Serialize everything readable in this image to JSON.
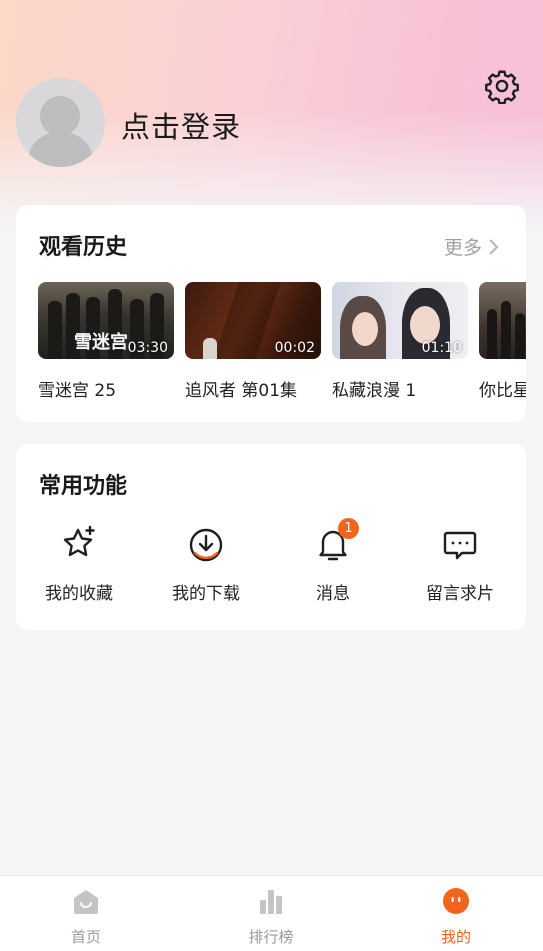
{
  "header": {
    "login_text": "点击登录",
    "settings_icon": "gear-icon",
    "avatar_icon": "default-avatar-icon"
  },
  "history": {
    "title": "观看历史",
    "more_label": "更多",
    "items": [
      {
        "title": "雪迷宫 25",
        "duration": "03:30"
      },
      {
        "title": "追风者 第01集",
        "duration": "00:02"
      },
      {
        "title": "私藏浪漫 1",
        "duration": "01:10"
      },
      {
        "title": "你比星",
        "duration": ""
      }
    ]
  },
  "features": {
    "title": "常用功能",
    "items": [
      {
        "label": "我的收藏",
        "icon": "star-icon"
      },
      {
        "label": "我的下载",
        "icon": "download-icon"
      },
      {
        "label": "消息",
        "icon": "bell-icon",
        "badge": "1"
      },
      {
        "label": "留言求片",
        "icon": "chat-icon"
      }
    ]
  },
  "tabbar": {
    "items": [
      {
        "label": "首页",
        "icon": "home-icon"
      },
      {
        "label": "排行榜",
        "icon": "chart-icon"
      },
      {
        "label": "我的",
        "icon": "profile-icon",
        "active": true
      }
    ]
  },
  "colors": {
    "accent": "#f2631b",
    "background": "#f4f5f7"
  }
}
